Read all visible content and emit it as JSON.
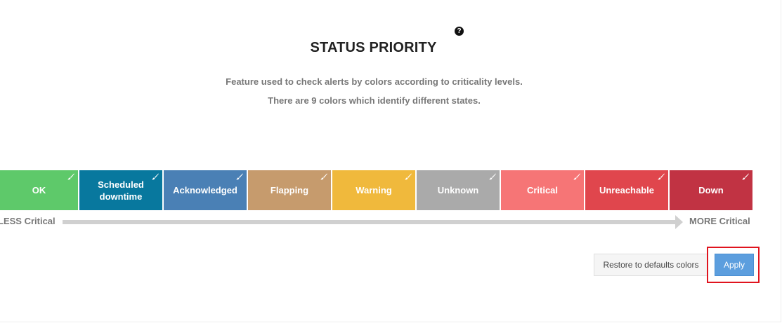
{
  "header": {
    "title": "STATUS PRIORITY",
    "help_icon": "question-circle-icon",
    "description_1": "Feature used to check alerts by colors according to criticality levels.",
    "description_2": "There are 9 colors which identify different states."
  },
  "statuses": [
    {
      "label": "OK",
      "color": "#5ec96a"
    },
    {
      "label": "Scheduled downtime",
      "color": "#08789e"
    },
    {
      "label": "Acknowledged",
      "color": "#4a80b5"
    },
    {
      "label": "Flapping",
      "color": "#c69b6d"
    },
    {
      "label": "Warning",
      "color": "#f0b93c"
    },
    {
      "label": "Unknown",
      "color": "#aaaaaa"
    },
    {
      "label": "Critical",
      "color": "#f67576"
    },
    {
      "label": "Unreachable",
      "color": "#e0464d"
    },
    {
      "label": "Down",
      "color": "#c13343"
    }
  ],
  "status_edit_icon": "paint-brush-icon",
  "scale": {
    "less_label": "LESS Critical",
    "more_label": "MORE Critical"
  },
  "actions": {
    "restore_label": "Restore to defaults colors",
    "apply_label": "Apply"
  }
}
